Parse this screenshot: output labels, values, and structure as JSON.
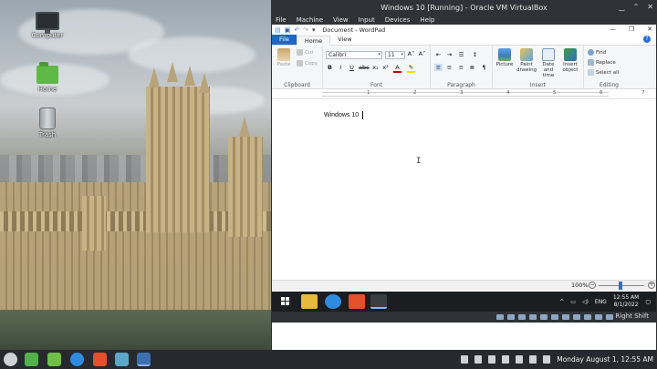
{
  "desktop": {
    "icons": [
      {
        "label": "Computer"
      },
      {
        "label": "Home"
      },
      {
        "label": "Trash"
      }
    ]
  },
  "vbox": {
    "title": "Windows 10 [Running] - Oracle VM VirtualBox",
    "menu": [
      "File",
      "Machine",
      "View",
      "Input",
      "Devices",
      "Help"
    ],
    "host_key": "Right Shift"
  },
  "wordpad": {
    "title": "Document - WordPad",
    "tabs": [
      "File",
      "Home",
      "View"
    ],
    "clipboard": {
      "paste": "Paste",
      "cut": "Cut",
      "copy": "Copy",
      "label": "Clipboard"
    },
    "font": {
      "family": "Calibri",
      "size": "11",
      "label": "Font"
    },
    "paragraph": {
      "label": "Paragraph"
    },
    "insert": {
      "picture": "Picture",
      "paint": "Paint drawing",
      "datetime": "Date and time",
      "object": "Insert object",
      "label": "Insert"
    },
    "editing": {
      "find": "Find",
      "replace": "Replace",
      "select_all": "Select all",
      "label": "Editing"
    },
    "ruler_numbers": [
      "1",
      "2",
      "3",
      "4",
      "5",
      "6",
      "7"
    ],
    "document_text": "Windows 10",
    "zoom": "100%"
  },
  "win10_taskbar": {
    "lang": "ENG",
    "time": "12:55 AM",
    "date": "8/1/2022"
  },
  "linux_panel": {
    "clock": "Monday August  1, 12:55 AM"
  },
  "colors": {
    "wordpad_file_tab": "#1e66c8",
    "vbox_chrome": "#2f3337",
    "panel_bg": "#262a2e"
  }
}
